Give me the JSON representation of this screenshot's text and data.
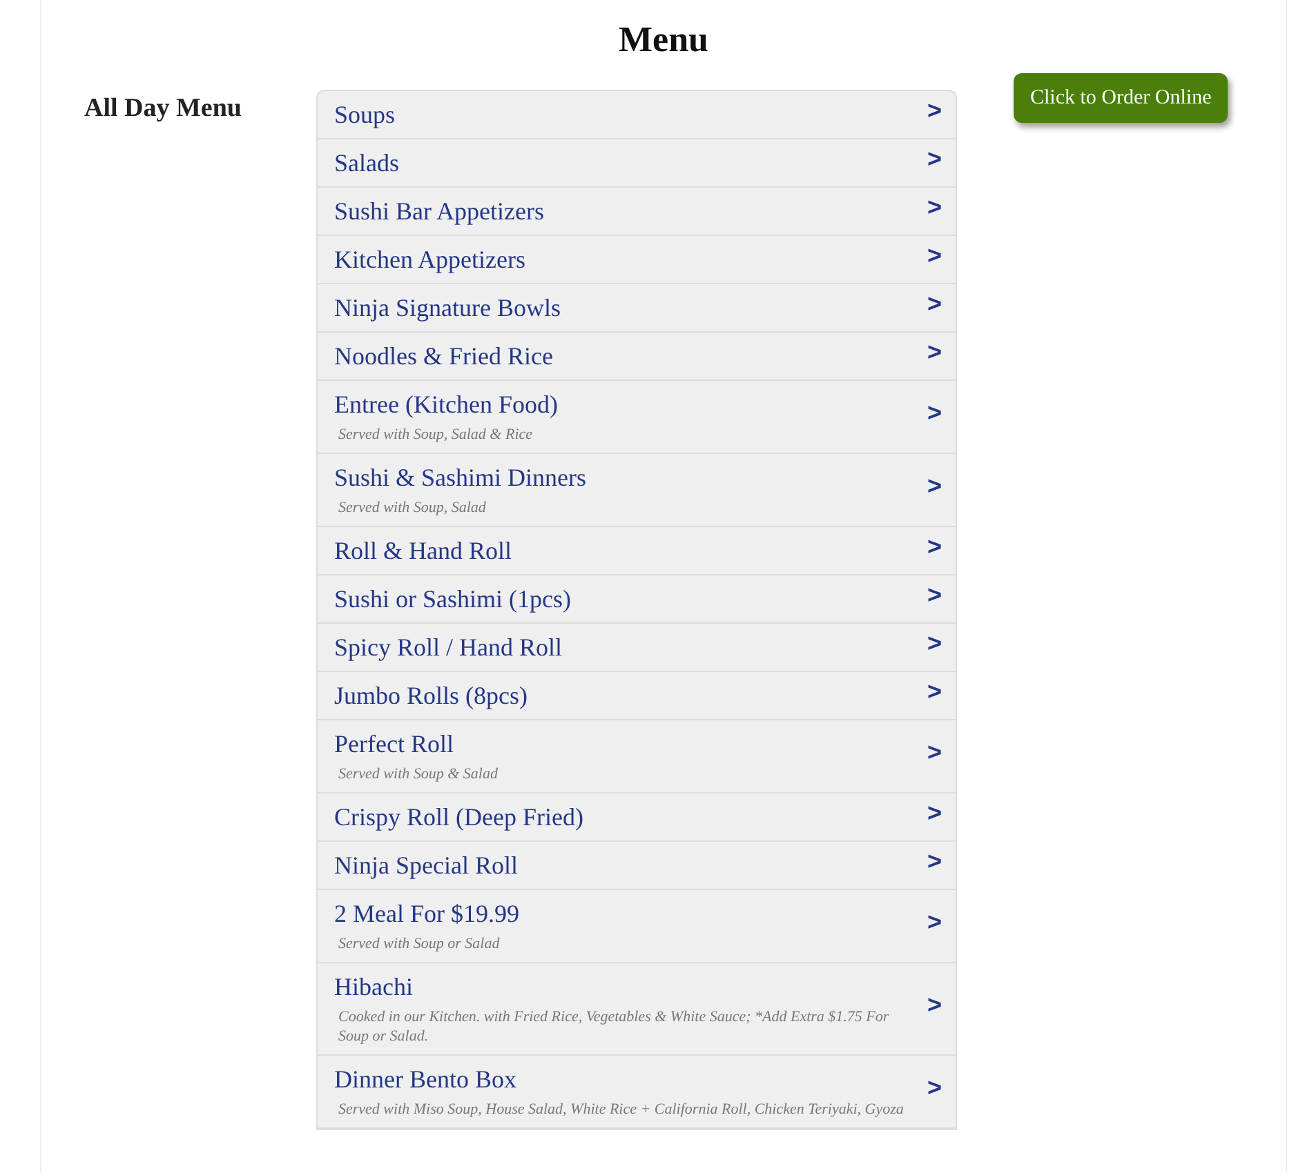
{
  "title": "Menu",
  "section_title": "All Day Menu",
  "categories": [
    {
      "name": "Soups",
      "chevron": ">"
    },
    {
      "name": "Salads",
      "chevron": ">"
    },
    {
      "name": "Sushi Bar Appetizers",
      "chevron": ">"
    },
    {
      "name": "Kitchen Appetizers",
      "chevron": ">"
    },
    {
      "name": "Ninja Signature Bowls",
      "chevron": ">"
    },
    {
      "name": "Noodles & Fried Rice",
      "chevron": ">"
    },
    {
      "name": "Entree (Kitchen Food)",
      "note": "Served with Soup, Salad & Rice",
      "chevron": ">"
    },
    {
      "name": "Sushi & Sashimi Dinners",
      "note": "Served with Soup, Salad",
      "chevron": ">"
    },
    {
      "name": "Roll & Hand Roll",
      "chevron": ">"
    },
    {
      "name": "Sushi or Sashimi (1pcs)",
      "chevron": ">"
    },
    {
      "name": "Spicy Roll / Hand Roll",
      "chevron": ">"
    },
    {
      "name": "Jumbo Rolls (8pcs)",
      "chevron": ">"
    },
    {
      "name": "Perfect Roll",
      "note": "Served with Soup & Salad",
      "chevron": ">"
    },
    {
      "name": "Crispy Roll (Deep Fried)",
      "chevron": ">"
    },
    {
      "name": "Ninja Special Roll",
      "chevron": ">"
    },
    {
      "name": "2 Meal For $19.99",
      "note": "Served with Soup or Salad",
      "chevron": ">"
    },
    {
      "name": "Hibachi",
      "note": "Cooked in our Kitchen. with Fried Rice, Vegetables & White Sauce; *Add Extra $1.75 For Soup or Salad.",
      "chevron": ">"
    },
    {
      "name": "Dinner Bento Box",
      "note": "Served with Miso Soup, House Salad, White Rice + California Roll, Chicken Teriyaki, Gyoza",
      "chevron": ">"
    }
  ],
  "order_button": "Click to Order Online"
}
